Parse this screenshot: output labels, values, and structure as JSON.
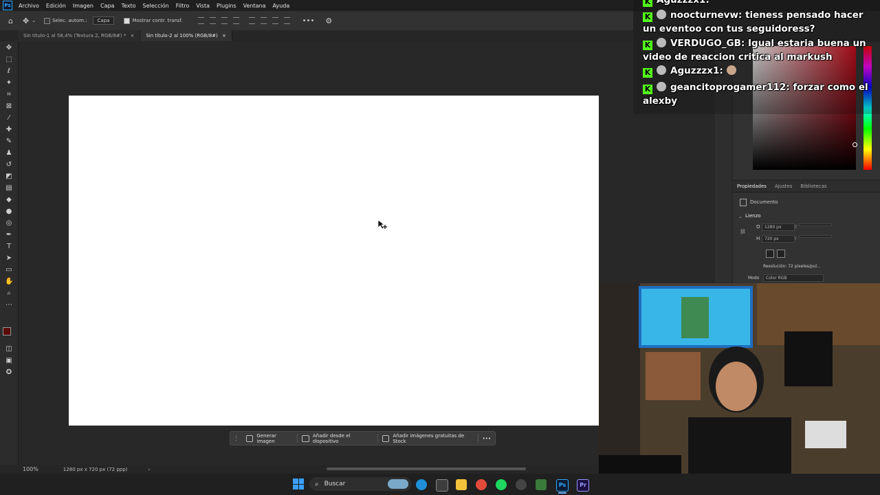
{
  "menu": {
    "app_icon": "Ps",
    "items": [
      "Archivo",
      "Edición",
      "Imagen",
      "Capa",
      "Texto",
      "Selección",
      "Filtro",
      "Vista",
      "Plugins",
      "Ventana",
      "Ayuda"
    ]
  },
  "options": {
    "auto_select_label": "Selec. autom.:",
    "layer_select": "Capa",
    "show_transform_label": "Mostrar contr. transf."
  },
  "tabs": [
    {
      "label": "Sin título-1 al 58,4% (Textura 2, RGB/8#) *",
      "close": "×"
    },
    {
      "label": "Sin título-2 al 100% (RGB/8#)",
      "close": "×"
    }
  ],
  "context_bar": {
    "generate": "Generar imagen",
    "add_device": "Añadir desde el dispositivo",
    "add_stock": "Añadir imágenes gratuitas de Stock",
    "more": "•••"
  },
  "status": {
    "zoom": "100%",
    "doc_size": "1280 px x 720 px (72 ppp)",
    "arrow": "›"
  },
  "properties": {
    "tabs": [
      "Propiedades",
      "Ajustes",
      "Bibliotecas"
    ],
    "doc_label": "Documento",
    "section": "Lienzo",
    "width_label": "O",
    "width_value": "1280 px",
    "height_label": "H",
    "height_value": "720 px",
    "x_label": "X",
    "y_label": "Y",
    "resolution": "Resolución: 72 píxeles/pul...",
    "mode_label": "Modo",
    "mode_value": "Color RGB"
  },
  "chat": [
    {
      "text": "Aguzzzx1:"
    },
    {
      "user": "noocturnevw:",
      "msg": "tieness pensado hacer un eventoo con tus seguidoress?"
    },
    {
      "user": "VERDUGO_GB:",
      "msg": "Igual estaria buena un video de reaccion critica al markush"
    },
    {
      "user": "Aguzzzx1:",
      "msg": ""
    },
    {
      "user": "geancitoprogamer112:",
      "msg": "forzar como el alexby"
    }
  ],
  "taskbar": {
    "search": "Buscar"
  },
  "colors": {
    "canvas": "#ffffff",
    "kick_green": "#53fc18",
    "ps_blue": "#31a8ff",
    "foreground_swatch": "#5a0a0a"
  }
}
